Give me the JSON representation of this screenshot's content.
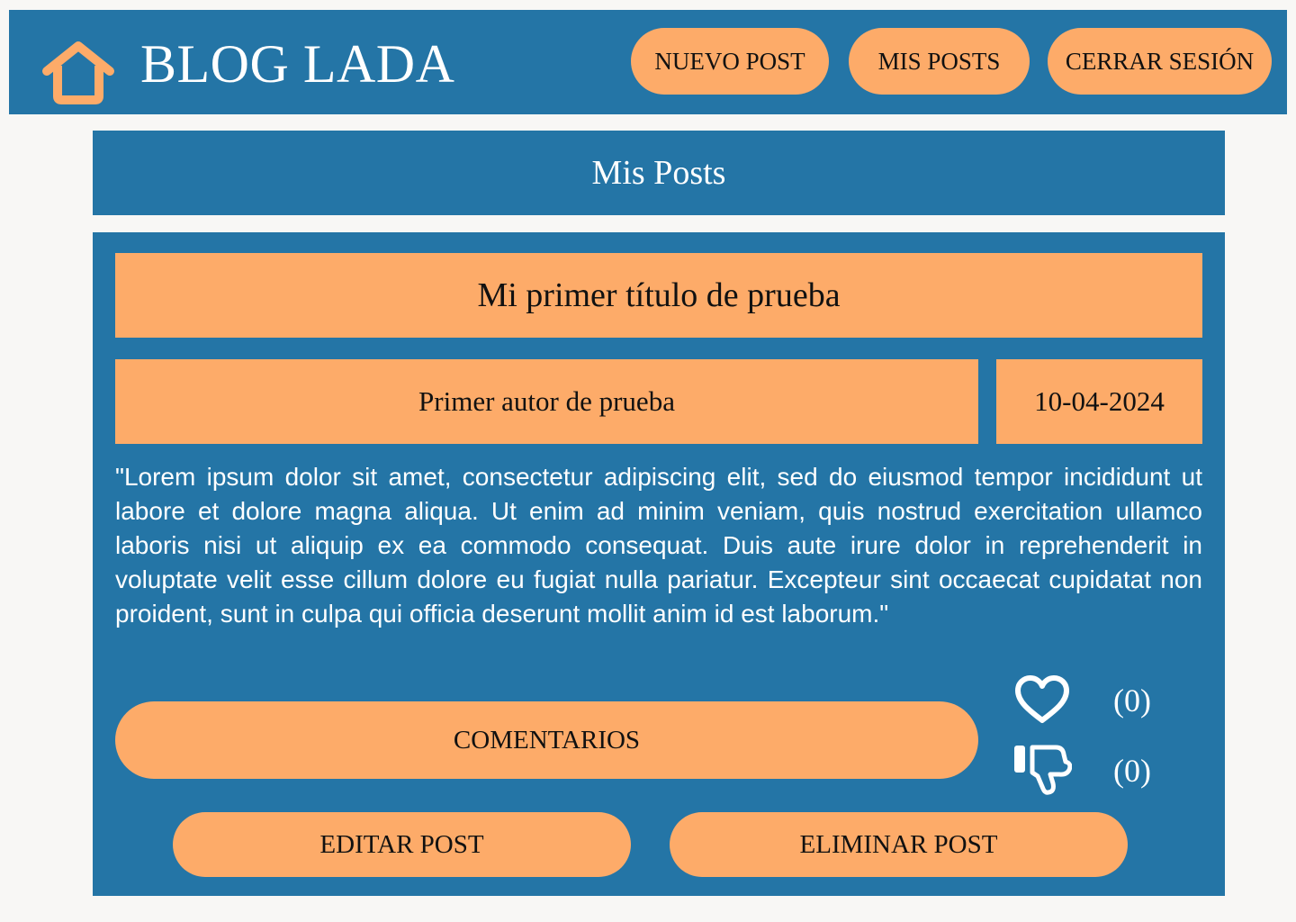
{
  "header": {
    "brand": "BLOG LADA",
    "home_icon": "house-icon",
    "nav": {
      "new_post": "NUEVO POST",
      "my_posts": "MIS POSTS",
      "logout": "CERRAR SESIÓN"
    }
  },
  "page": {
    "title": "Mis Posts"
  },
  "post": {
    "title": "Mi primer título de prueba",
    "author": "Primer autor de prueba",
    "date": "10-04-2024",
    "body": "\"Lorem ipsum dolor sit amet, consectetur adipiscing elit, sed do eiusmod tempor incididunt ut labore et dolore magna aliqua. Ut enim ad minim veniam, quis nostrud exercitation ullamco laboris nisi ut aliquip ex ea commodo consequat. Duis aute irure dolor in reprehenderit in voluptate velit esse cillum dolore eu fugiat nulla pariatur. Excepteur sint occaecat cupidatat non proident, sunt in culpa qui officia deserunt mollit anim id est laborum.\"",
    "comments_label": "COMENTARIOS",
    "likes": {
      "icon": "heart-icon",
      "count": "(0)"
    },
    "dislikes": {
      "icon": "thumbs-down-icon",
      "count": "(0)"
    },
    "edit_label": "EDITAR POST",
    "delete_label": "ELIMINAR POST"
  },
  "colors": {
    "primary": "#2475a6",
    "accent": "#fdab69",
    "background": "#f8f7f5",
    "text_dark": "#111111",
    "text_light": "#ffffff"
  }
}
